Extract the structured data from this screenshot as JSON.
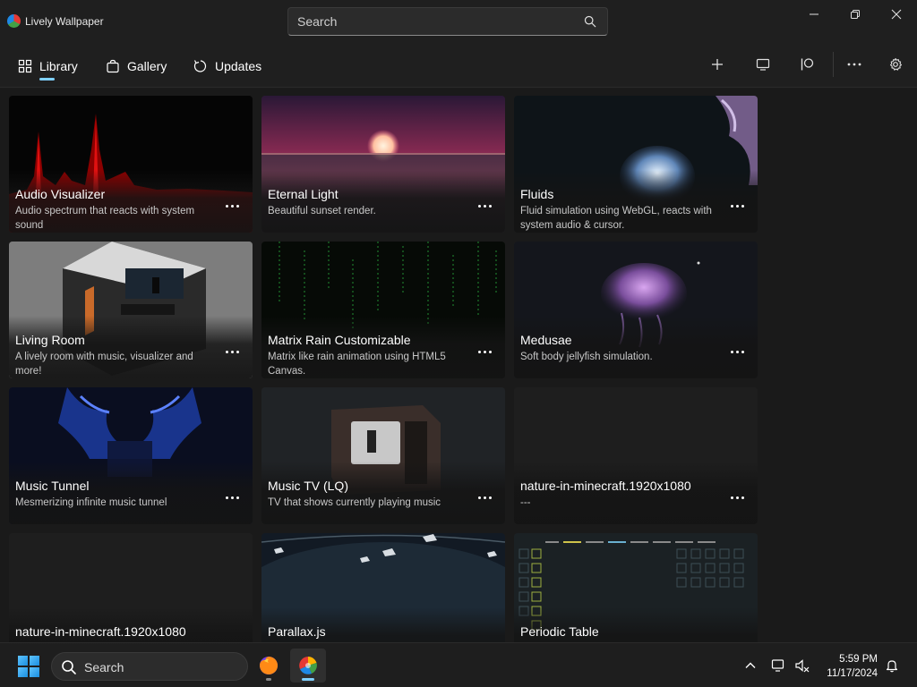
{
  "app": {
    "title": "Lively Wallpaper",
    "search_placeholder": "Search"
  },
  "nav": {
    "items": [
      {
        "label": "Library",
        "icon": "grid-icon",
        "selected": true
      },
      {
        "label": "Gallery",
        "icon": "shopping-bag-icon",
        "selected": false
      },
      {
        "label": "Updates",
        "icon": "refresh-icon",
        "selected": false
      }
    ],
    "accent_color": "#7fd0ff"
  },
  "toolbar": {
    "icons": [
      "plus-icon",
      "monitor-icon",
      "patreon-icon",
      "more-options-icon",
      "settings-icon"
    ]
  },
  "library": {
    "tiles": [
      {
        "title": "Audio Visualizer",
        "description": "Audio spectrum that reacts with system sound"
      },
      {
        "title": "Eternal Light",
        "description": "Beautiful sunset render."
      },
      {
        "title": "Fluids",
        "description": "Fluid simulation using WebGL, reacts with system audio & cursor."
      },
      {
        "title": "Living Room",
        "description": "A lively room with music, visualizer and more!"
      },
      {
        "title": "Matrix Rain Customizable",
        "description": "Matrix like rain animation using HTML5 Canvas."
      },
      {
        "title": "Medusae",
        "description": "Soft body jellyfish simulation."
      },
      {
        "title": "Music Tunnel",
        "description": "Mesmerizing infinite music tunnel"
      },
      {
        "title": "Music TV (LQ)",
        "description": "TV that shows currently playing music"
      },
      {
        "title": "nature-in-minecraft.1920x1080",
        "description": "---"
      },
      {
        "title": "nature-in-minecraft.1920x1080",
        "description": ""
      },
      {
        "title": "Parallax.js",
        "description": ""
      },
      {
        "title": "Periodic Table",
        "description": ""
      }
    ]
  },
  "taskbar": {
    "search_label": "Search",
    "time": "5:59 PM",
    "date": "11/17/2024"
  }
}
